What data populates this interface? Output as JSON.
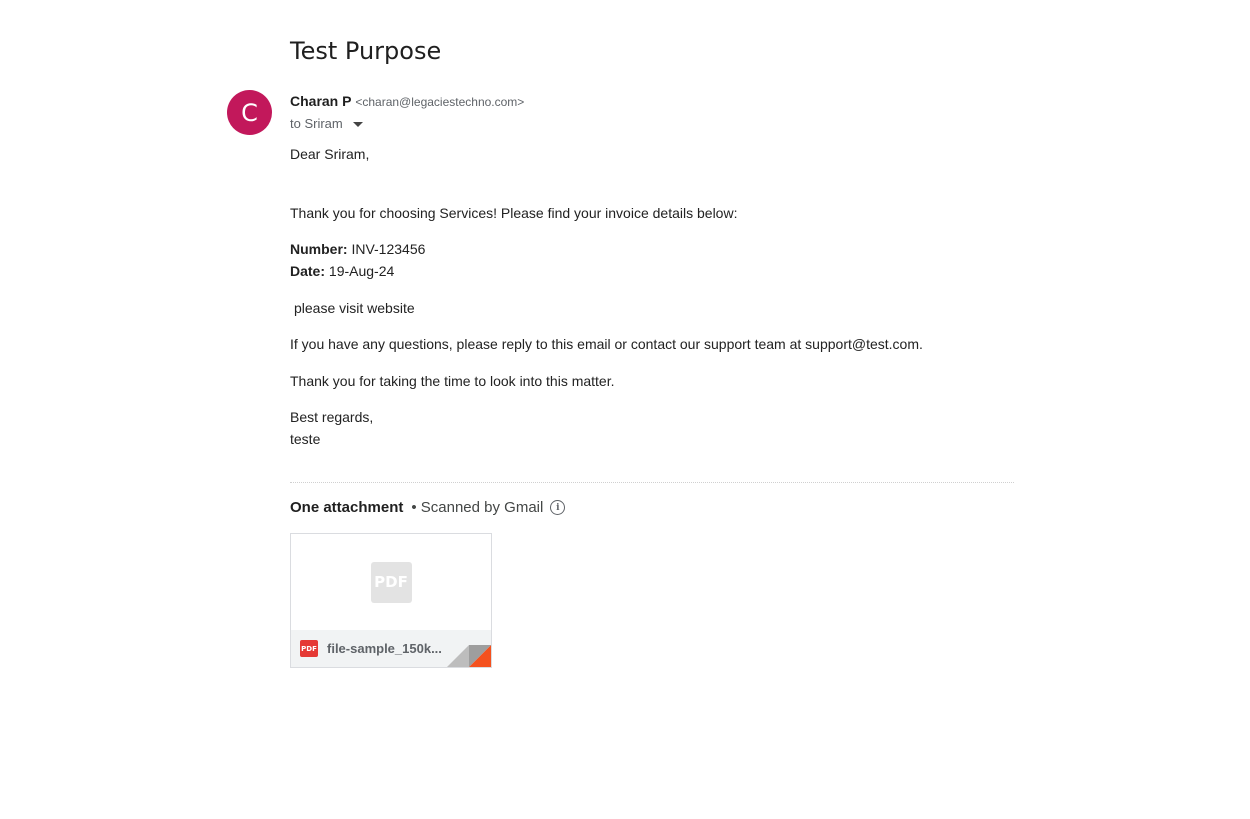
{
  "email": {
    "subject": "Test Purpose",
    "sender": {
      "avatar_letter": "C",
      "avatar_color": "#c2185b",
      "name": "Charan P",
      "email": "<charan@legaciestechno.com>"
    },
    "recipient_line": "to Sriram",
    "body": {
      "greeting": "Dear Sriram,",
      "intro": "Thank you for choosing Services! Please find your invoice details below:",
      "number_label": "Number:",
      "number_value": "INV-123456",
      "date_label": "Date:",
      "date_value": "19-Aug-24",
      "visit": "please visit website",
      "questions": "If you have any questions, please reply to this email or contact our support team at support@test.com.",
      "thanks": "Thank you for taking the time to look into this matter.",
      "signoff": "Best regards,",
      "signature": "teste"
    }
  },
  "attachments": {
    "header_count": "One attachment",
    "header_scanned": "• Scanned by Gmail",
    "items": [
      {
        "file_name": "file-sample_150k...",
        "preview_label": "PDF",
        "badge_label": "PDF",
        "icon": "pdf-icon",
        "badge_color": "#e53935"
      }
    ]
  },
  "icons": {
    "info": "info-icon",
    "dropdown": "caret-down-icon"
  }
}
